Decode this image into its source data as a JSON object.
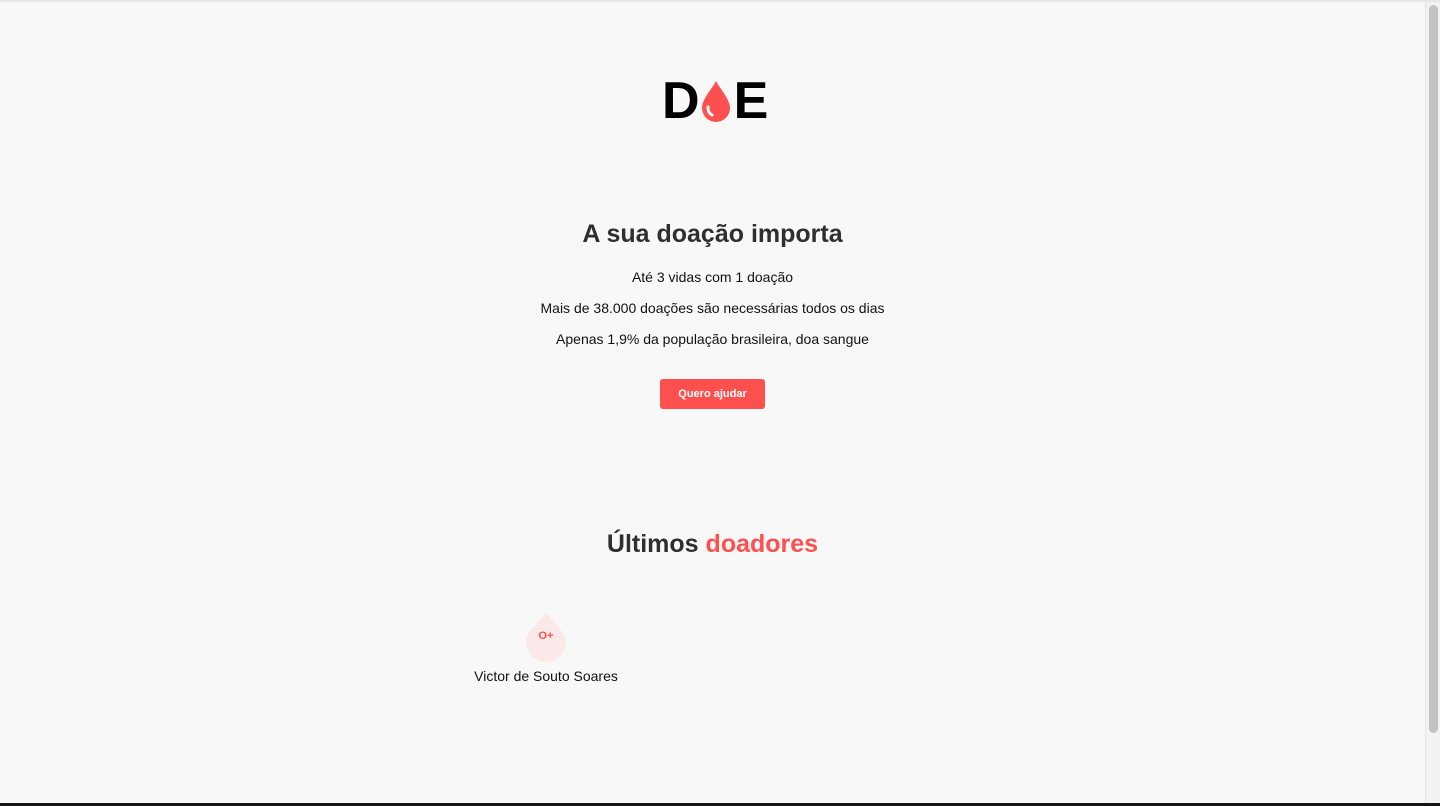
{
  "logo": {
    "letter_left": "D",
    "letter_right": "E",
    "drop_color": "#ff4f4f",
    "icon": "blood-drop-icon"
  },
  "hero": {
    "title": "A sua doação importa",
    "lines": [
      "Até 3 vidas com 1 doação",
      "Mais de 38.000 doações são necessárias todos os dias",
      "Apenas 1,9% da população brasileira, doa sangue"
    ],
    "button_label": "Quero ajudar"
  },
  "donors": {
    "title_plain": "Últimos",
    "title_accent": "doadores",
    "items": [
      {
        "blood_type": "O+",
        "name": "Victor de Souto Soares"
      }
    ]
  },
  "colors": {
    "accent": "#ff4f4f",
    "background": "#f8f8f9",
    "text": "#2f2f2f",
    "drop_light": "#fbe9ea"
  }
}
